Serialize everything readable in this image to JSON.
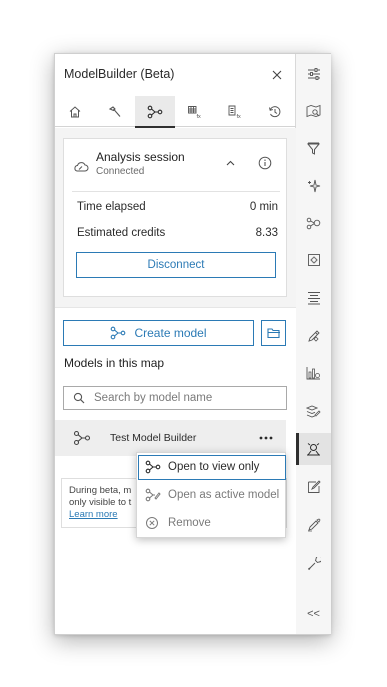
{
  "panel": {
    "title": "ModelBuilder (Beta)",
    "close_icon": "close-icon"
  },
  "tabs": [
    {
      "name": "home",
      "icon": "home-icon"
    },
    {
      "name": "tools",
      "icon": "hammer-icon"
    },
    {
      "name": "model",
      "icon": "model-graph-icon",
      "active": true
    },
    {
      "name": "function-table",
      "icon": "table-fx-icon"
    },
    {
      "name": "function-doc",
      "icon": "doc-fx-icon"
    },
    {
      "name": "history",
      "icon": "history-icon"
    }
  ],
  "session": {
    "title": "Analysis session",
    "status": "Connected",
    "rows": [
      {
        "label": "Time elapsed",
        "value": "0 min"
      },
      {
        "label": "Estimated credits",
        "value": "8.33"
      }
    ],
    "disconnect_label": "Disconnect"
  },
  "models": {
    "create_label": "Create model",
    "section_title": "Models in this map",
    "search_placeholder": "Search by model name",
    "items": [
      {
        "label": "Test Model Builder"
      }
    ]
  },
  "beta_notice": {
    "line1": "During beta, m",
    "line2": "only visible to t",
    "learn_more": "Learn more"
  },
  "menu": {
    "items": [
      {
        "label": "Open to view only",
        "icon": "model-graph-icon",
        "focused": true
      },
      {
        "label": "Open as active model",
        "icon": "model-edit-icon"
      },
      {
        "label": "Remove",
        "icon": "remove-circle-icon"
      }
    ]
  },
  "toolbar": {
    "items": [
      {
        "name": "settings",
        "icon": "sliders-icon"
      },
      {
        "name": "map-layers",
        "icon": "map-search-icon"
      },
      {
        "name": "filter",
        "icon": "filter-icon"
      },
      {
        "name": "sparkle",
        "icon": "sparkle-icon"
      },
      {
        "name": "analysis",
        "icon": "analysis-icon"
      },
      {
        "name": "settings-gear",
        "icon": "gear-box-icon"
      },
      {
        "name": "align",
        "icon": "align-icon"
      },
      {
        "name": "edit",
        "icon": "pencil-diamond-icon"
      },
      {
        "name": "chart",
        "icon": "chart-icon"
      },
      {
        "name": "layers-edit",
        "icon": "layers-edit-icon"
      },
      {
        "name": "modelbuilder",
        "icon": "modelbuilder-icon",
        "active": true
      },
      {
        "name": "sketch",
        "icon": "sketch-icon"
      },
      {
        "name": "draw",
        "icon": "draw-icon"
      },
      {
        "name": "tools",
        "icon": "wrench-icon"
      }
    ],
    "collapse_label": "<<"
  },
  "colors": {
    "accent": "#2b7ab5",
    "active_tab_bg": "#eaeaea",
    "content_bg": "#f4f4f4"
  }
}
